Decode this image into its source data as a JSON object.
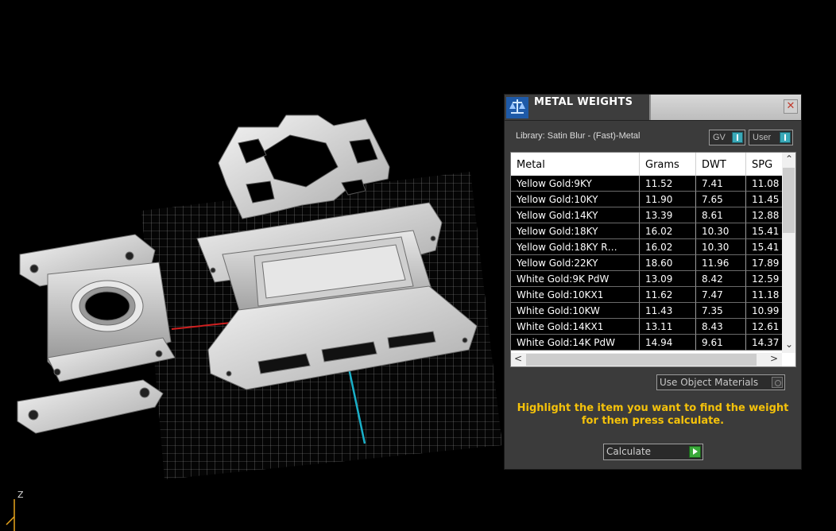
{
  "panel": {
    "title": "METAL WEIGHTS",
    "close_glyph": "✕",
    "library": "Library: Satin Blur - (Fast)-Metal",
    "gv_label": "GV",
    "user_label": "User",
    "table": {
      "columns": [
        "Metal",
        "Grams",
        "DWT",
        "SPG"
      ],
      "rows": [
        [
          "Yellow Gold:9KY",
          "11.52",
          "7.41",
          "11.08"
        ],
        [
          "Yellow Gold:10KY",
          "11.90",
          "7.65",
          "11.45"
        ],
        [
          "Yellow Gold:14KY",
          "13.39",
          "8.61",
          "12.88"
        ],
        [
          "Yellow Gold:18KY",
          "16.02",
          "10.30",
          "15.41"
        ],
        [
          "Yellow Gold:18KY R…",
          "16.02",
          "10.30",
          "15.41"
        ],
        [
          "Yellow Gold:22KY",
          "18.60",
          "11.96",
          "17.89"
        ],
        [
          "White Gold:9K PdW",
          "13.09",
          "8.42",
          "12.59"
        ],
        [
          "White Gold:10KX1",
          "11.62",
          "7.47",
          "11.18"
        ],
        [
          "White Gold:10KW",
          "11.43",
          "7.35",
          "10.99"
        ],
        [
          "White Gold:14KX1",
          "13.11",
          "8.43",
          "12.61"
        ],
        [
          "White Gold:14K PdW",
          "14.94",
          "9.61",
          "14.37"
        ]
      ]
    },
    "use_object_materials": "Use Object Materials",
    "instruction": "Highlight the item you want to find the weight for then press calculate.",
    "calculate": "Calculate"
  },
  "viewport": {
    "axis_label": "Z"
  }
}
